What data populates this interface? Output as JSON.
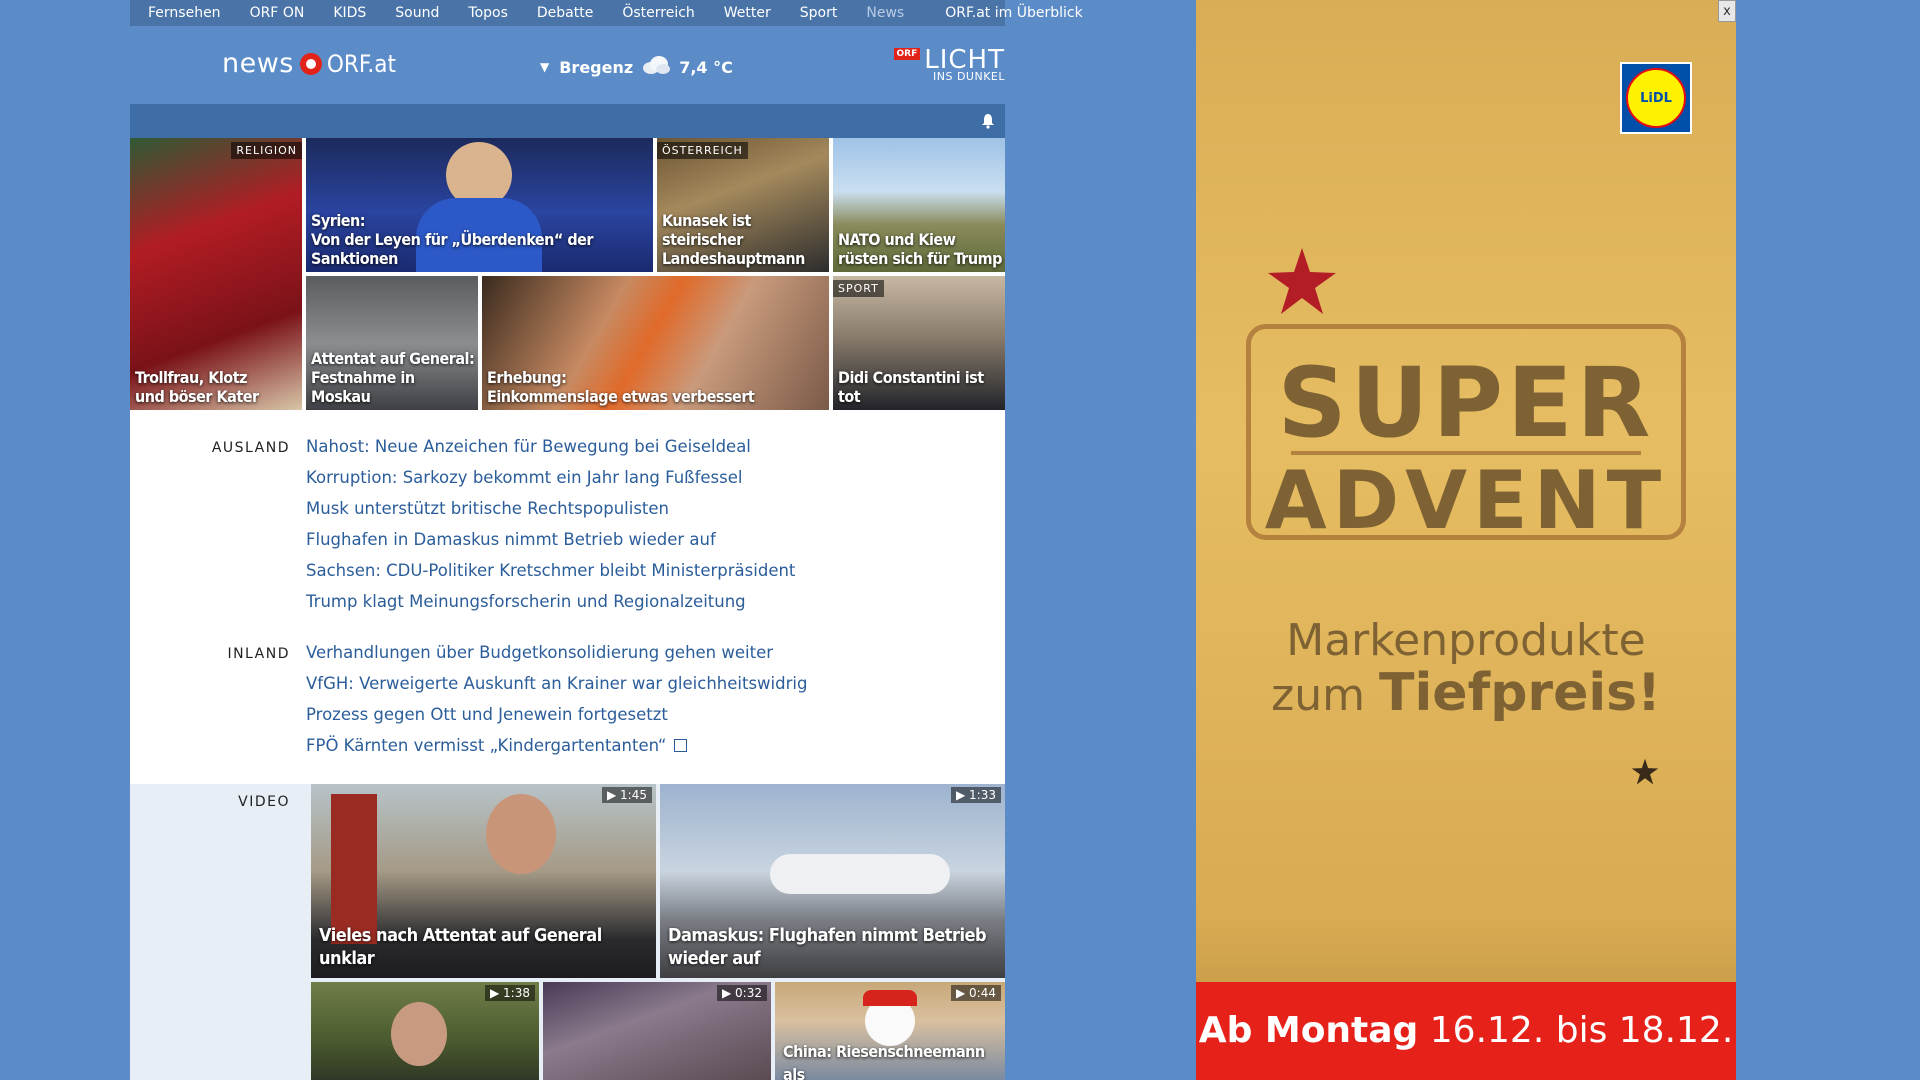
{
  "topnav": {
    "items": [
      "Fernsehen",
      "ORF ON",
      "KIDS",
      "Sound",
      "Topos",
      "Debatte",
      "Österreich",
      "Wetter",
      "Sport",
      "News"
    ],
    "overview": "ORF.at im Überblick"
  },
  "header": {
    "logo_news": "news",
    "logo_orf": "ORF.at",
    "weather_city": "Bregenz",
    "weather_temp": "7,4 °C",
    "licht_badge": "ORF",
    "licht_title": "LICHT",
    "licht_sub": "INS DUNKEL"
  },
  "teasers": [
    {
      "tag": "RELIGION",
      "line1": "Trollfrau, Klotz",
      "line2": "und böser Kater"
    },
    {
      "tag": "",
      "line1": "Syrien:",
      "line2": "Von der Leyen für „Überdenken“ der Sanktionen"
    },
    {
      "tag": "ÖSTERREICH",
      "line1": "Kunasek ist steirischer",
      "line2": "Landeshauptmann"
    },
    {
      "tag": "",
      "line1": "NATO und Kiew",
      "line2": "rüsten sich für Trump"
    },
    {
      "tag": "",
      "line1": "Attentat auf General:",
      "line2": "Festnahme in Moskau"
    },
    {
      "tag": "",
      "line1": "Erhebung:",
      "line2": "Einkommenslage etwas verbessert"
    },
    {
      "tag": "SPORT",
      "line1": "Didi Constantini ist tot",
      "line2": ""
    }
  ],
  "ausland": {
    "label": "AUSLAND",
    "items": [
      "Nahost: Neue Anzeichen für Bewegung bei Geiseldeal",
      "Korruption: Sarkozy bekommt ein Jahr lang Fußfessel",
      "Musk unterstützt britische Rechtspopulisten",
      "Flughafen in Damaskus nimmt Betrieb wieder auf",
      "Sachsen: CDU-Politiker Kretschmer bleibt Ministerpräsident",
      "Trump klagt Meinungsforscherin und Regionalzeitung"
    ]
  },
  "inland": {
    "label": "INLAND",
    "items": [
      "Verhandlungen über Budgetkonsolidierung gehen weiter",
      "VfGH: Verweigerte Auskunft an Krainer war gleichheitswidrig",
      "Prozess gegen Ott und Jenewein fortgesetzt",
      "FPÖ Kärnten vermisst „Kindergartentanten“"
    ]
  },
  "video": {
    "label": "VIDEO",
    "items": [
      {
        "duration": "1:45",
        "line1": "Vieles nach Attentat auf General unklar",
        "line2": ""
      },
      {
        "duration": "1:33",
        "line1": "Damaskus: Flughafen nimmt Betrieb",
        "line2": "wieder auf"
      },
      {
        "duration": "1:38",
        "line1": "",
        "line2": ""
      },
      {
        "duration": "0:32",
        "line1": "",
        "line2": ""
      },
      {
        "duration": "0:44",
        "line1": "China: Riesenschneemann als",
        "line2": ""
      }
    ]
  },
  "ad": {
    "close": "x",
    "brand": "LiDL",
    "super": "SUPER",
    "advent": "ADVENT",
    "line1": "Markenprodukte",
    "line2_plain": "zum ",
    "line2_bold": "Tiefpreis!",
    "foot_bold": "Ab Montag",
    "foot_rest": " 16.12. bis 18.12."
  }
}
